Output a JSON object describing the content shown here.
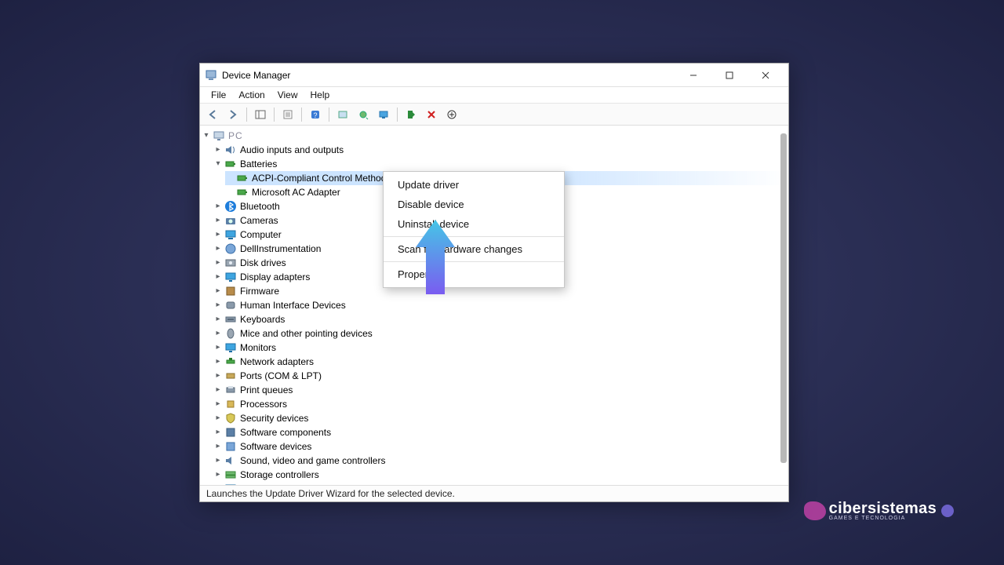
{
  "window": {
    "title": "Device Manager"
  },
  "menubar": {
    "items": [
      "File",
      "Action",
      "View",
      "Help"
    ]
  },
  "toolbar": {
    "buttons": [
      {
        "name": "back-icon"
      },
      {
        "name": "forward-icon"
      },
      {
        "sep": true
      },
      {
        "name": "show-hide-console-tree-icon"
      },
      {
        "sep": true
      },
      {
        "name": "properties-icon"
      },
      {
        "sep": true
      },
      {
        "name": "help-icon"
      },
      {
        "sep": true
      },
      {
        "name": "action-icon"
      },
      {
        "name": "scan-icon"
      },
      {
        "name": "update-driver-icon"
      },
      {
        "sep": true
      },
      {
        "name": "enable-icon"
      },
      {
        "name": "uninstall-icon"
      },
      {
        "name": "scan-hardware-icon"
      }
    ]
  },
  "tree": {
    "root_label": "PC",
    "nodes": [
      {
        "icon": "audio-icon",
        "label": "Audio inputs and outputs",
        "expandable": true,
        "expanded": false
      },
      {
        "icon": "battery-icon",
        "label": "Batteries",
        "expandable": true,
        "expanded": true,
        "children": [
          {
            "icon": "battery-icon",
            "label": "ACPI-Compliant Control Method Battery",
            "selected": true
          },
          {
            "icon": "battery-icon",
            "label": "Microsoft AC Adapter"
          }
        ]
      },
      {
        "icon": "bluetooth-icon",
        "label": "Bluetooth",
        "expandable": true
      },
      {
        "icon": "camera-icon",
        "label": "Cameras",
        "expandable": true
      },
      {
        "icon": "computer-icon",
        "label": "Computer",
        "expandable": true
      },
      {
        "icon": "dell-icon",
        "label": "DellInstrumentation",
        "expandable": true
      },
      {
        "icon": "disk-icon",
        "label": "Disk drives",
        "expandable": true
      },
      {
        "icon": "display-icon",
        "label": "Display adapters",
        "expandable": true
      },
      {
        "icon": "firmware-icon",
        "label": "Firmware",
        "expandable": true
      },
      {
        "icon": "hid-icon",
        "label": "Human Interface Devices",
        "expandable": true
      },
      {
        "icon": "keyboard-icon",
        "label": "Keyboards",
        "expandable": true
      },
      {
        "icon": "mouse-icon",
        "label": "Mice and other pointing devices",
        "expandable": true
      },
      {
        "icon": "monitor-icon",
        "label": "Monitors",
        "expandable": true
      },
      {
        "icon": "network-icon",
        "label": "Network adapters",
        "expandable": true
      },
      {
        "icon": "ports-icon",
        "label": "Ports (COM & LPT)",
        "expandable": true
      },
      {
        "icon": "printer-icon",
        "label": "Print queues",
        "expandable": true
      },
      {
        "icon": "processor-icon",
        "label": "Processors",
        "expandable": true
      },
      {
        "icon": "security-icon",
        "label": "Security devices",
        "expandable": true
      },
      {
        "icon": "component-icon",
        "label": "Software components",
        "expandable": true
      },
      {
        "icon": "software-icon",
        "label": "Software devices",
        "expandable": true
      },
      {
        "icon": "sound-icon",
        "label": "Sound, video and game controllers",
        "expandable": true
      },
      {
        "icon": "storage-icon",
        "label": "Storage controllers",
        "expandable": true
      },
      {
        "icon": "system-icon",
        "label": "System devices",
        "expandable": true
      }
    ]
  },
  "context_menu": {
    "items": [
      {
        "label": "Update driver"
      },
      {
        "label": "Disable device"
      },
      {
        "label": "Uninstall device"
      },
      {
        "sep": true
      },
      {
        "label": "Scan for hardware changes"
      },
      {
        "sep": true
      },
      {
        "label": "Properties"
      }
    ]
  },
  "statusbar": {
    "text": "Launches the Update Driver Wizard for the selected device."
  },
  "brand": {
    "text": "cibersistemas",
    "sub": "GAMES E TECNOLOGIA"
  },
  "colors": {
    "selection_bg": "#cce4ff",
    "arrow_top": "#45c6e6",
    "arrow_bottom": "#7a5cf0"
  }
}
